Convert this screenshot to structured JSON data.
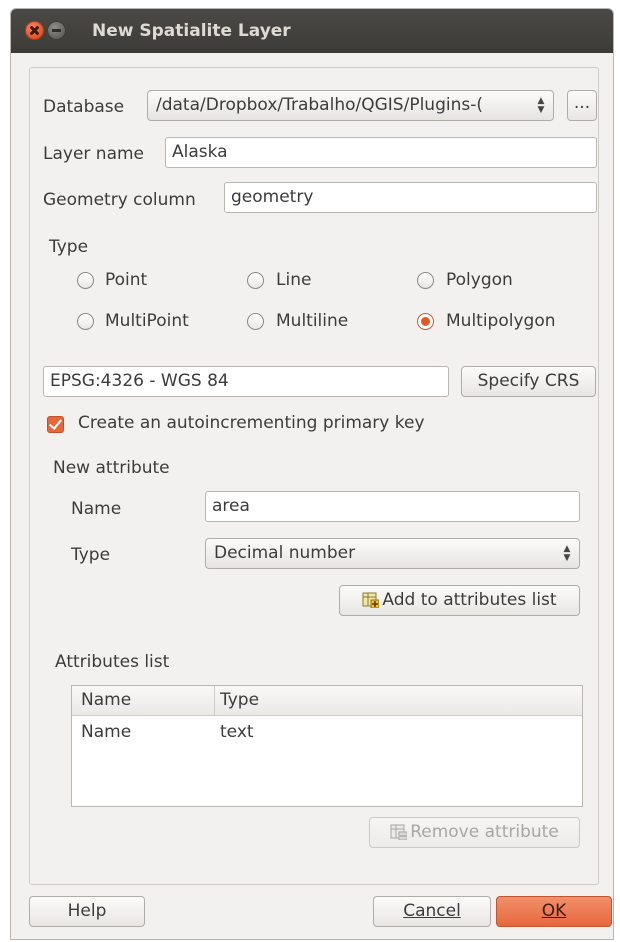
{
  "window": {
    "title": "New Spatialite Layer"
  },
  "database": {
    "label": "Database",
    "value": "/data/Dropbox/Trabalho/QGIS/Plugins-(",
    "browse_label": "..."
  },
  "layer_name": {
    "label": "Layer name",
    "value": "Alaska"
  },
  "geometry_column": {
    "label": "Geometry column",
    "value": "geometry"
  },
  "type": {
    "label": "Type",
    "options": [
      {
        "label": "Point",
        "checked": false
      },
      {
        "label": "Line",
        "checked": false
      },
      {
        "label": "Polygon",
        "checked": false
      },
      {
        "label": "MultiPoint",
        "checked": false
      },
      {
        "label": "Multiline",
        "checked": false
      },
      {
        "label": "Multipolygon",
        "checked": true
      }
    ]
  },
  "crs": {
    "value": "EPSG:4326 - WGS 84",
    "button_label": "Specify CRS"
  },
  "primary_key": {
    "label": "Create an autoincrementing primary key",
    "checked": true
  },
  "new_attribute": {
    "label": "New attribute",
    "name_label": "Name",
    "name_value": "area",
    "type_label": "Type",
    "type_value": "Decimal number",
    "add_button_label": "Add to attributes list"
  },
  "attributes_list": {
    "label": "Attributes list",
    "columns": [
      "Name",
      "Type"
    ],
    "rows": [
      {
        "name": "Name",
        "type": "text"
      }
    ],
    "remove_button_label": "Remove attribute"
  },
  "footer": {
    "help_label": "Help",
    "cancel_label": "Cancel",
    "ok_label": "OK"
  },
  "colors": {
    "accent": "#e6683d",
    "titlebar": "#3c3b37",
    "window_bg": "#f2f1f0"
  },
  "icons": {
    "close": "close-icon",
    "minimize": "minimize-icon",
    "add": "add-attribute-icon",
    "remove": "remove-attribute-icon"
  }
}
